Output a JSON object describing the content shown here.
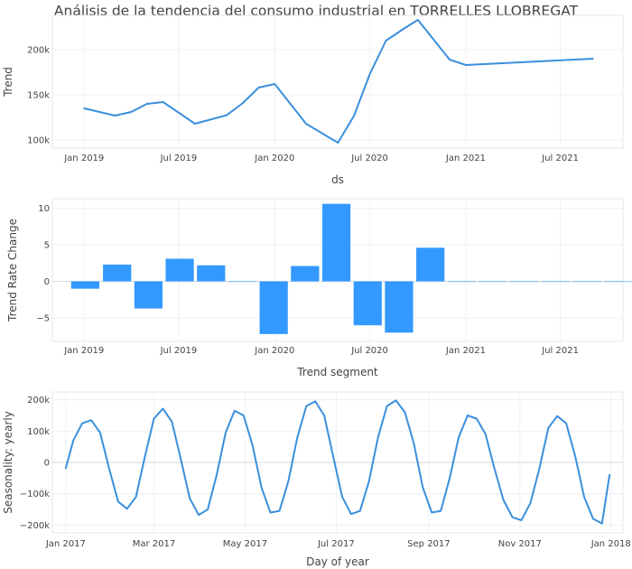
{
  "title": "Análisis de la tendencia del consumo industrial en TORRELLES LLOBREGAT",
  "colors": {
    "line": "#3a8fdc",
    "bar": "#3399ff"
  },
  "chart_data": [
    {
      "type": "line",
      "name": "trend",
      "xlabel": "ds",
      "ylabel": "Trend",
      "xlim": [
        "2018-11-01",
        "2021-10-29"
      ],
      "ylim": [
        91000,
        238000
      ],
      "x_ticks": [
        {
          "value": "2019-01-01",
          "label": "Jan 2019"
        },
        {
          "value": "2019-07-01",
          "label": "Jul 2019"
        },
        {
          "value": "2020-01-01",
          "label": "Jan 2020"
        },
        {
          "value": "2020-07-01",
          "label": "Jul 2020"
        },
        {
          "value": "2021-01-01",
          "label": "Jan 2021"
        },
        {
          "value": "2021-07-01",
          "label": "Jul 2021"
        }
      ],
      "y_ticks": [
        {
          "value": 100000,
          "label": "100k"
        },
        {
          "value": 150000,
          "label": "150k"
        },
        {
          "value": 200000,
          "label": "200k"
        }
      ],
      "grid": true,
      "x": [
        "2019-01-01",
        "2019-03-01",
        "2019-04-01",
        "2019-05-01",
        "2019-06-01",
        "2019-08-01",
        "2019-10-01",
        "2019-11-01",
        "2019-12-01",
        "2020-01-01",
        "2020-03-01",
        "2020-05-01",
        "2020-06-01",
        "2020-07-01",
        "2020-08-01",
        "2020-09-01",
        "2020-10-01",
        "2020-12-01",
        "2021-01-01",
        "2021-09-01"
      ],
      "y": [
        135000,
        127000,
        131000,
        140000,
        142000,
        118000,
        127500,
        141000,
        158000,
        162000,
        118000,
        97000,
        127000,
        173000,
        210000,
        222000,
        233000,
        189000,
        183000,
        190000
      ]
    },
    {
      "type": "bar",
      "name": "trend-rate-change",
      "xlabel": "Trend segment",
      "ylabel": "Trend Rate Change",
      "xlim": [
        "2018-11-01",
        "2021-10-29"
      ],
      "ylim": [
        -8.2,
        11.3
      ],
      "x_ticks": [
        {
          "value": "2019-01-01",
          "label": "Jan 2019"
        },
        {
          "value": "2019-07-01",
          "label": "Jul 2019"
        },
        {
          "value": "2020-01-01",
          "label": "Jan 2020"
        },
        {
          "value": "2020-07-01",
          "label": "Jul 2020"
        },
        {
          "value": "2021-01-01",
          "label": "Jan 2021"
        },
        {
          "value": "2021-07-01",
          "label": "Jul 2021"
        }
      ],
      "y_ticks": [
        {
          "value": -5,
          "label": "−5"
        },
        {
          "value": 0,
          "label": "0"
        },
        {
          "value": 5,
          "label": "5"
        },
        {
          "value": 10,
          "label": "10"
        }
      ],
      "grid": true,
      "bar_width_days": 54,
      "x": [
        "2019-01-03",
        "2019-03-05",
        "2019-05-04",
        "2019-07-03",
        "2019-09-01",
        "2019-10-31",
        "2019-12-30",
        "2020-02-28",
        "2020-04-28",
        "2020-06-27",
        "2020-08-26",
        "2020-10-25",
        "2020-12-24",
        "2021-02-22",
        "2021-04-23",
        "2021-06-22",
        "2021-08-21",
        "2021-10-20"
      ],
      "values": [
        -1.0,
        2.3,
        -3.7,
        3.1,
        2.2,
        0.0,
        -7.2,
        2.1,
        10.6,
        -6.0,
        -7.0,
        4.6,
        0.0,
        0.0,
        0.0,
        0.0,
        0.0,
        0.0
      ]
    },
    {
      "type": "line",
      "name": "seasonality-yearly",
      "xlabel": "Day of year",
      "ylabel": "Seasonality: yearly",
      "xlim": [
        "2016-12-23",
        "2018-01-09"
      ],
      "ylim": [
        -225000,
        225000
      ],
      "x_ticks": [
        {
          "value": "2017-01-01",
          "label": "Jan 2017"
        },
        {
          "value": "2017-03-01",
          "label": "Mar 2017"
        },
        {
          "value": "2017-05-01",
          "label": "May 2017"
        },
        {
          "value": "2017-07-01",
          "label": "Jul 2017"
        },
        {
          "value": "2017-09-01",
          "label": "Sep 2017"
        },
        {
          "value": "2017-11-01",
          "label": "Nov 2017"
        },
        {
          "value": "2018-01-01",
          "label": "Jan 2018"
        }
      ],
      "y_ticks": [
        {
          "value": -200000,
          "label": "−200k"
        },
        {
          "value": -100000,
          "label": "−100k"
        },
        {
          "value": 0,
          "label": "0"
        },
        {
          "value": 100000,
          "label": "100k"
        },
        {
          "value": 200000,
          "label": "200k"
        }
      ],
      "grid": true,
      "x": [
        "2017-01-01",
        "2017-01-06",
        "2017-01-12",
        "2017-01-18",
        "2017-01-24",
        "2017-01-30",
        "2017-02-05",
        "2017-02-11",
        "2017-02-17",
        "2017-02-23",
        "2017-03-01",
        "2017-03-07",
        "2017-03-13",
        "2017-03-19",
        "2017-03-25",
        "2017-03-31",
        "2017-04-06",
        "2017-04-12",
        "2017-04-18",
        "2017-04-24",
        "2017-04-30",
        "2017-05-06",
        "2017-05-12",
        "2017-05-18",
        "2017-05-24",
        "2017-05-30",
        "2017-06-05",
        "2017-06-11",
        "2017-06-17",
        "2017-06-23",
        "2017-06-29",
        "2017-07-05",
        "2017-07-11",
        "2017-07-17",
        "2017-07-23",
        "2017-07-29",
        "2017-08-04",
        "2017-08-10",
        "2017-08-16",
        "2017-08-22",
        "2017-08-28",
        "2017-09-03",
        "2017-09-09",
        "2017-09-15",
        "2017-09-21",
        "2017-09-27",
        "2017-10-03",
        "2017-10-09",
        "2017-10-15",
        "2017-10-21",
        "2017-10-27",
        "2017-11-02",
        "2017-11-08",
        "2017-11-14",
        "2017-11-20",
        "2017-11-26",
        "2017-12-02",
        "2017-12-08",
        "2017-12-14",
        "2017-12-20",
        "2017-12-26",
        "2017-12-31"
      ],
      "y": [
        -18000,
        70000,
        125000,
        135000,
        95000,
        -20000,
        -125000,
        -148000,
        -110000,
        20000,
        140000,
        172000,
        130000,
        10000,
        -115000,
        -168000,
        -150000,
        -40000,
        95000,
        165000,
        150000,
        55000,
        -80000,
        -160000,
        -155000,
        -60000,
        80000,
        180000,
        195000,
        150000,
        20000,
        -110000,
        -165000,
        -155000,
        -60000,
        80000,
        180000,
        198000,
        160000,
        60000,
        -80000,
        -160000,
        -155000,
        -50000,
        80000,
        150000,
        140000,
        90000,
        -20000,
        -120000,
        -175000,
        -185000,
        -130000,
        -20000,
        110000,
        148000,
        125000,
        20000,
        -110000,
        -180000,
        -195000,
        -40000
      ]
    }
  ]
}
